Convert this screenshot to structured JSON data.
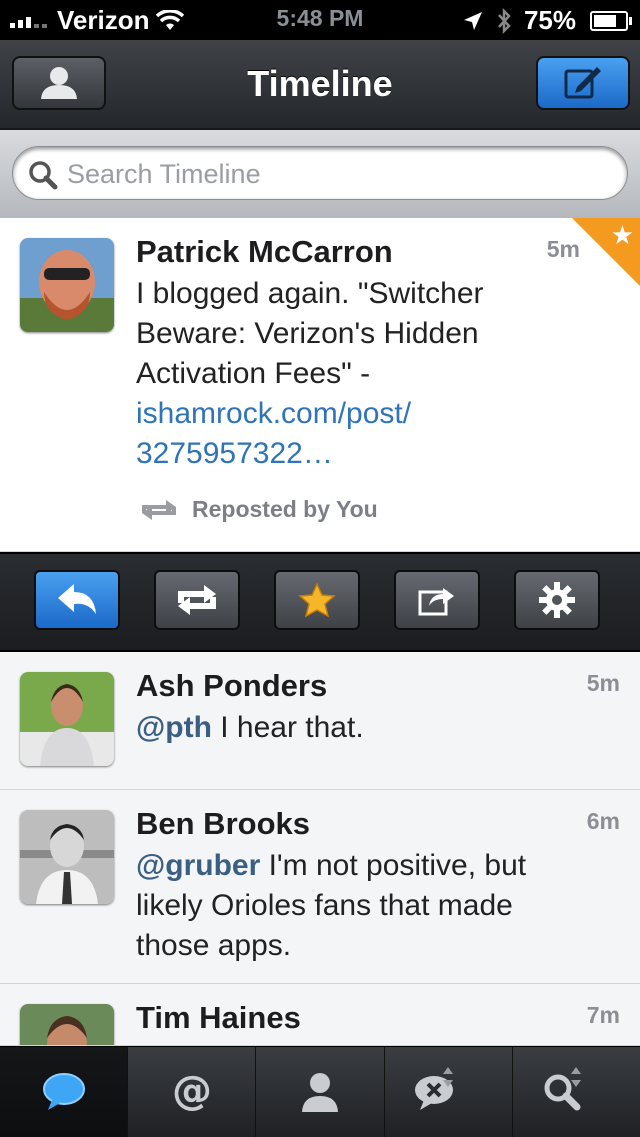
{
  "status_bar": {
    "carrier": "Verizon",
    "time": "5:48 PM",
    "battery": "75%"
  },
  "nav": {
    "title": "Timeline"
  },
  "search": {
    "placeholder": "Search Timeline"
  },
  "tweets": [
    {
      "author": "Patrick McCarron",
      "time": "5m",
      "text": "I blogged again. \"Switcher Beware: Verizon's Hidden Activation Fees\" - ",
      "link": "ishamrock.com/post/ 3275957322…",
      "repost": "Reposted by You",
      "favorited": true
    },
    {
      "author": "Ash Ponders",
      "time": "5m",
      "mention": "@pth",
      "text": " I hear that."
    },
    {
      "author": "Ben Brooks",
      "time": "6m",
      "mention": "@gruber",
      "text": " I'm not positive, but likely Orioles fans that made those apps."
    },
    {
      "author": "Tim Haines",
      "time": "7m"
    }
  ],
  "actions": [
    "reply-icon",
    "repost-icon",
    "favorite-icon",
    "share-icon",
    "gear-icon"
  ],
  "tabs": [
    "timeline-icon",
    "mentions-icon",
    "profile-icon",
    "messages-icon",
    "search-icon"
  ],
  "colors": {
    "accent_blue": "#1b69c8",
    "favorite_orange": "#f39a1f",
    "link_blue": "#2f73b8"
  }
}
